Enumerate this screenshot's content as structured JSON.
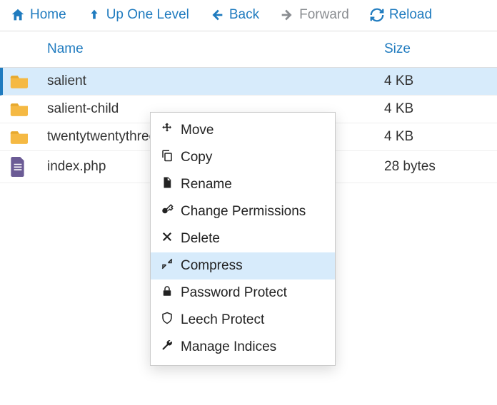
{
  "toolbar": {
    "home": "Home",
    "up": "Up One Level",
    "back": "Back",
    "forward": "Forward",
    "reload": "Reload"
  },
  "columns": {
    "name": "Name",
    "size": "Size"
  },
  "rows": [
    {
      "name": "salient",
      "size": "4 KB",
      "type": "folder",
      "selected": true
    },
    {
      "name": "salient-child",
      "size": "4 KB",
      "type": "folder",
      "selected": false
    },
    {
      "name": "twentytwentythree",
      "size": "4 KB",
      "type": "folder",
      "selected": false
    },
    {
      "name": "index.php",
      "size": "28 bytes",
      "type": "file-php",
      "selected": false
    }
  ],
  "context_menu": {
    "items": [
      {
        "label": "Move",
        "icon": "move-icon",
        "highlight": false
      },
      {
        "label": "Copy",
        "icon": "copy-icon",
        "highlight": false
      },
      {
        "label": "Rename",
        "icon": "rename-icon",
        "highlight": false
      },
      {
        "label": "Change Permissions",
        "icon": "key-icon",
        "highlight": false
      },
      {
        "label": "Delete",
        "icon": "delete-icon",
        "highlight": false
      },
      {
        "label": "Compress",
        "icon": "compress-icon",
        "highlight": true
      },
      {
        "label": "Password Protect",
        "icon": "lock-icon",
        "highlight": false
      },
      {
        "label": "Leech Protect",
        "icon": "shield-icon",
        "highlight": false
      },
      {
        "label": "Manage Indices",
        "icon": "wrench-icon",
        "highlight": false
      }
    ]
  },
  "colors": {
    "accent": "#1f7bbf",
    "selection": "#d7ebfb",
    "disabled": "#8a8d91",
    "folder": "#f5b943",
    "file_php": "#6b5b95"
  }
}
